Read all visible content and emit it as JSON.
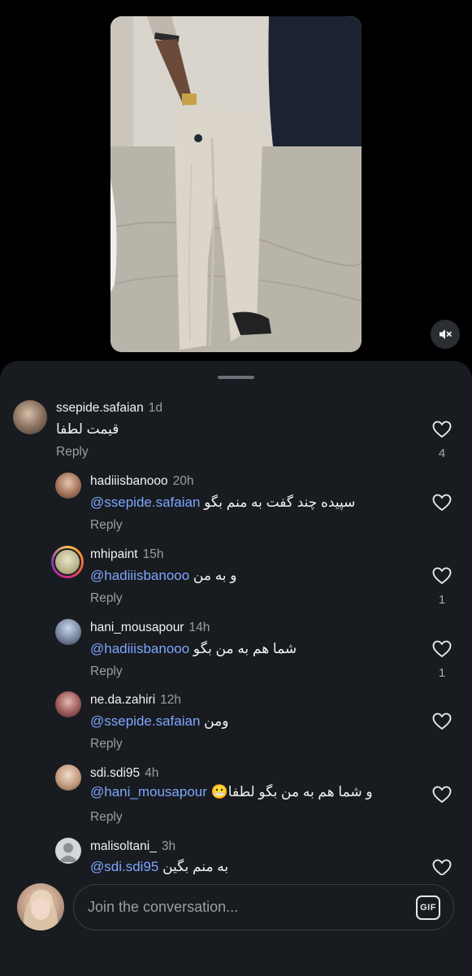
{
  "composer": {
    "placeholder": "Join the conversation...",
    "gif_label": "GIF"
  },
  "comments": [
    {
      "username": "ssepide.safaian",
      "time": "1d",
      "mention": "",
      "text": "قيمت لطفا",
      "reply_label": "Reply",
      "likes": "4"
    },
    {
      "username": "hadiiisbanooo",
      "time": "20h",
      "mention": "@ssepide.safaian",
      "text": "سپیده چند گفت به منم بگو",
      "reply_label": "Reply",
      "likes": ""
    },
    {
      "username": "mhipaint",
      "time": "15h",
      "mention": "@hadiiisbanooo",
      "text": "و به من",
      "reply_label": "Reply",
      "likes": "1"
    },
    {
      "username": "hani_mousapour",
      "time": "14h",
      "mention": "@hadiiisbanooo",
      "text": "شما هم به من بگو",
      "reply_label": "Reply",
      "likes": "1"
    },
    {
      "username": "ne.da.zahiri",
      "time": "12h",
      "mention": "@ssepide.safaian",
      "text": "ومن",
      "reply_label": "Reply",
      "likes": ""
    },
    {
      "username": "sdi.sdi95",
      "time": "4h",
      "mention": "@hani_mousapour",
      "text": "و شما هم به من بگو لطفا😬",
      "reply_label": "Reply",
      "likes": ""
    },
    {
      "username": "malisoltani_",
      "time": "3h",
      "mention": "@sdi.sdi95",
      "text": "به منم بگین",
      "reply_label": "",
      "likes": ""
    }
  ],
  "icons": {
    "mute": "speaker-muted-icon",
    "like": "heart-outline-icon",
    "gif": "gif-icon"
  },
  "colors": {
    "background": "#000000",
    "sheet": "#181b1f",
    "mention": "#7ea6ff",
    "secondary_text": "#9a9ea5"
  }
}
